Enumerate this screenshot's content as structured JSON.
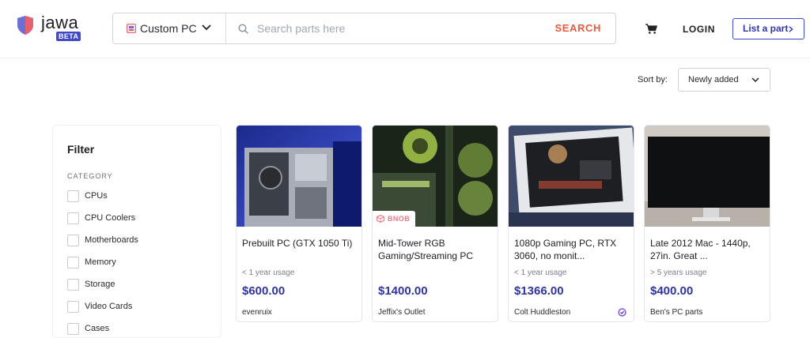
{
  "brand": {
    "name": "jawa",
    "badge": "BETA",
    "colors": {
      "accent": "#4047c9",
      "search": "#e45b3d",
      "price": "#30349e"
    }
  },
  "search": {
    "category": "Custom PC",
    "placeholder": "Search parts here",
    "button": "SEARCH"
  },
  "nav": {
    "login": "LOGIN",
    "list_part": "List a part"
  },
  "sort": {
    "label": "Sort by:",
    "value": "Newly added"
  },
  "filter": {
    "title": "Filter",
    "section": "CATEGORY",
    "categories": [
      "CPUs",
      "CPU Coolers",
      "Motherboards",
      "Memory",
      "Storage",
      "Video Cards",
      "Cases"
    ]
  },
  "listings": [
    {
      "title": "Prebuilt PC (GTX 1050 Ti)",
      "usage": "< 1 year usage",
      "price": "$600.00",
      "seller": "evenruix"
    },
    {
      "title": "Mid-Tower RGB Gaming/Streaming PC",
      "usage": "",
      "price": "$1400.00",
      "seller": "Jeffix's Outlet",
      "tag": "BNOB"
    },
    {
      "title": "1080p Gaming PC, RTX 3060, no monit...",
      "usage": "< 1 year usage",
      "price": "$1366.00",
      "seller": "Colt Huddleston",
      "verified": true
    },
    {
      "title": "Late 2012 Mac - 1440p, 27in. Great ...",
      "usage": "> 5 years usage",
      "price": "$400.00",
      "seller": "Ben's PC parts"
    }
  ]
}
